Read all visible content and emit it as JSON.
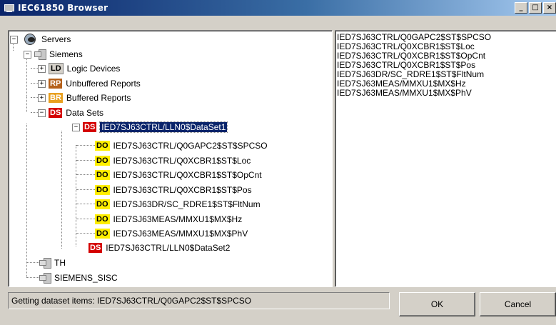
{
  "window": {
    "title": "IEC61850 Browser",
    "buttons": [
      "_",
      "□",
      "×"
    ]
  },
  "tree": {
    "root": "Servers",
    "siemens": "Siemens",
    "categories": [
      {
        "badge": "LD",
        "label": "Logic Devices"
      },
      {
        "badge": "RP",
        "label": "Unbuffered Reports"
      },
      {
        "badge": "BR",
        "label": "Buffered Reports"
      },
      {
        "badge": "DS",
        "label": "Data Sets"
      }
    ],
    "dataset1": {
      "badge": "DS",
      "label": "IED7SJ63CTRL/LLN0$DataSet1"
    },
    "data_objects": [
      {
        "badge": "DO",
        "label": "IED7SJ63CTRL/Q0GAPC2$ST$SPCSO"
      },
      {
        "badge": "DO",
        "label": "IED7SJ63CTRL/Q0XCBR1$ST$Loc"
      },
      {
        "badge": "DO",
        "label": "IED7SJ63CTRL/Q0XCBR1$ST$OpCnt"
      },
      {
        "badge": "DO",
        "label": "IED7SJ63CTRL/Q0XCBR1$ST$Pos"
      },
      {
        "badge": "DO",
        "label": "IED7SJ63DR/SC_RDRE1$ST$FltNum"
      },
      {
        "badge": "DO",
        "label": "IED7SJ63MEAS/MMXU1$MX$Hz"
      },
      {
        "badge": "DO",
        "label": "IED7SJ63MEAS/MMXU1$MX$PhV"
      }
    ],
    "dataset2": {
      "badge": "DS",
      "label": "IED7SJ63CTRL/LLN0$DataSet2"
    },
    "server_th": "TH",
    "server_siemens_sisc": "SIEMENS_SISC"
  },
  "list": [
    "IED7SJ63CTRL/Q0GAPC2$ST$SPCSO",
    "IED7SJ63CTRL/Q0XCBR1$ST$Loc",
    "IED7SJ63CTRL/Q0XCBR1$ST$OpCnt",
    "IED7SJ63CTRL/Q0XCBR1$ST$Pos",
    "IED7SJ63DR/SC_RDRE1$ST$FltNum",
    "IED7SJ63MEAS/MMXU1$MX$Hz",
    "IED7SJ63MEAS/MMXU1$MX$PhV"
  ],
  "status": "Getting dataset items: IED7SJ63CTRL/Q0GAPC2$ST$SPCSO",
  "buttons": {
    "ok": "OK",
    "cancel": "Cancel"
  }
}
